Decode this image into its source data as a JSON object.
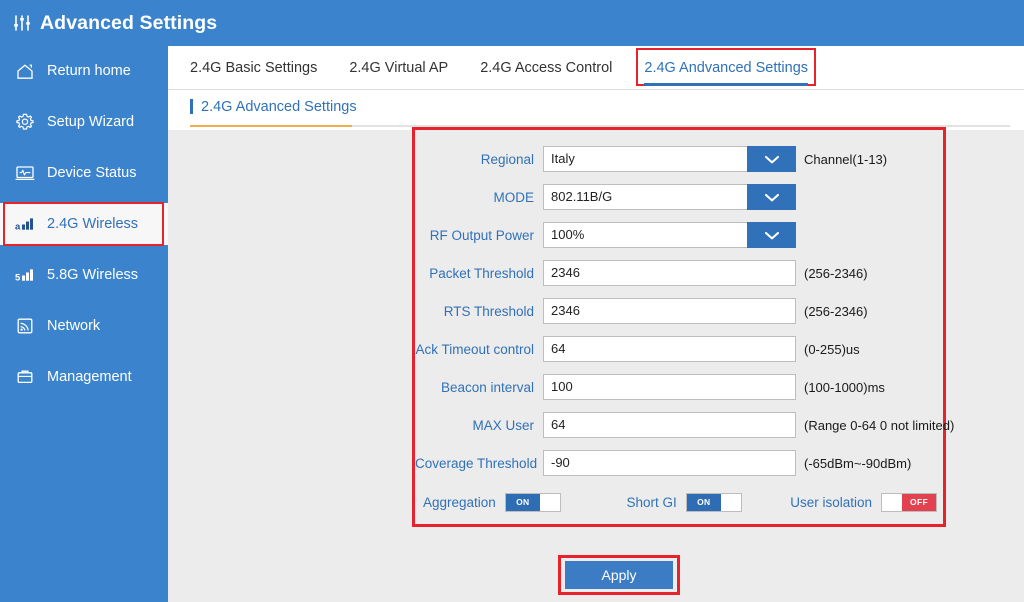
{
  "header": {
    "title": "Advanced Settings",
    "icon": "sliders-icon"
  },
  "sidebar": {
    "items": [
      {
        "label": "Return home",
        "icon": "home-icon",
        "active": false
      },
      {
        "label": "Setup Wizard",
        "icon": "gear-icon",
        "active": false
      },
      {
        "label": "Device Status",
        "icon": "monitor-pulse-icon",
        "active": false
      },
      {
        "label": "2.4G Wireless",
        "icon": "signal-bars-24g-icon",
        "active": true
      },
      {
        "label": "5.8G Wireless",
        "icon": "signal-bars-58g-icon",
        "active": false
      },
      {
        "label": "Network",
        "icon": "wifi-signal-icon",
        "active": false
      },
      {
        "label": "Management",
        "icon": "briefcase-icon",
        "active": false
      }
    ]
  },
  "tabs": [
    {
      "label": "2.4G Basic Settings",
      "active": false
    },
    {
      "label": "2.4G Virtual AP",
      "active": false
    },
    {
      "label": "2.4G Access Control",
      "active": false
    },
    {
      "label": "2.4G Andvanced Settings",
      "active": true
    }
  ],
  "section": {
    "title": "2.4G Advanced Settings"
  },
  "form": {
    "rows": [
      {
        "label": "Regional",
        "value": "Italy",
        "hint": "Channel(1-13)",
        "type": "select"
      },
      {
        "label": "MODE",
        "value": "802.11B/G",
        "hint": "",
        "type": "select"
      },
      {
        "label": "RF Output Power",
        "value": "100%",
        "hint": "",
        "type": "select"
      },
      {
        "label": "Packet Threshold",
        "value": "2346",
        "hint": "(256-2346)",
        "type": "text"
      },
      {
        "label": "RTS Threshold",
        "value": "2346",
        "hint": "(256-2346)",
        "type": "text"
      },
      {
        "label": "Ack Timeout control",
        "value": "64",
        "hint": "(0-255)us",
        "type": "text"
      },
      {
        "label": "Beacon interval",
        "value": "100",
        "hint": "(100-1000)ms",
        "type": "text"
      },
      {
        "label": "MAX User",
        "value": "64",
        "hint": "(Range 0-64 0 not limited)",
        "type": "text"
      },
      {
        "label": "Coverage Threshold",
        "value": "-90",
        "hint": "(-65dBm~-90dBm)",
        "type": "text"
      }
    ],
    "toggles": [
      {
        "label": "Aggregation",
        "state": "ON",
        "on_text": "ON",
        "off_text": "OFF"
      },
      {
        "label": "Short GI",
        "state": "ON",
        "on_text": "ON",
        "off_text": "OFF"
      },
      {
        "label": "User isolation",
        "state": "OFF",
        "on_text": "ON",
        "off_text": "OFF"
      }
    ]
  },
  "apply": {
    "label": "Apply"
  },
  "colors": {
    "brand_blue": "#3b84cd",
    "accent_blue": "#3071b9",
    "annotation_red": "#e8222c",
    "toggle_off_red": "#e2414f",
    "rule_orange": "#f0ae4e",
    "page_bg": "#ececec"
  }
}
